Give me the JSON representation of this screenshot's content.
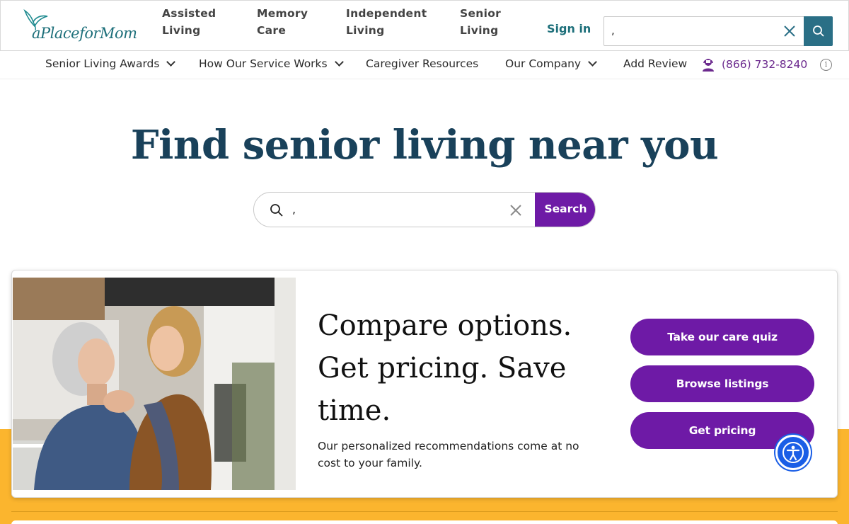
{
  "brand": {
    "logo_text": "aPlaceforMom",
    "logo_color": "#1d6f7a",
    "primary_purple": "#6e1aa6",
    "heading_color": "#19415a",
    "band_color": "#fbb52e"
  },
  "top_nav": {
    "items": [
      {
        "line1": "Assisted",
        "line2": "Living"
      },
      {
        "line1": "Memory",
        "line2": "Care"
      },
      {
        "line1": "Independent",
        "line2": "Living"
      },
      {
        "line1": "Senior",
        "line2": "Living"
      }
    ],
    "sign_in": "Sign in",
    "search": {
      "value": ",",
      "clear_icon": "close-icon",
      "button_icon": "search-icon"
    }
  },
  "sub_nav": {
    "items": [
      {
        "label": "Senior Living Awards",
        "has_dropdown": true
      },
      {
        "label": "How Our Service Works",
        "has_dropdown": true
      },
      {
        "label": "Caregiver Resources",
        "has_dropdown": false
      },
      {
        "label": "Our Company",
        "has_dropdown": true
      },
      {
        "label": "Add Review",
        "has_dropdown": false
      }
    ],
    "phone": "(866) 732-8240",
    "phone_icon": "advisor-headset-icon",
    "info_icon": "info-icon"
  },
  "hero": {
    "title": "Find senior living near you",
    "search_value": ",",
    "search_button": "Search"
  },
  "promo": {
    "heading": "Compare options. Get pricing. Save time.",
    "text": "Our personalized recommendations come at no cost to your family.",
    "buttons": [
      "Take our care quiz",
      "Browse listings",
      "Get pricing"
    ]
  },
  "accessibility_button_icon": "accessibility-icon"
}
